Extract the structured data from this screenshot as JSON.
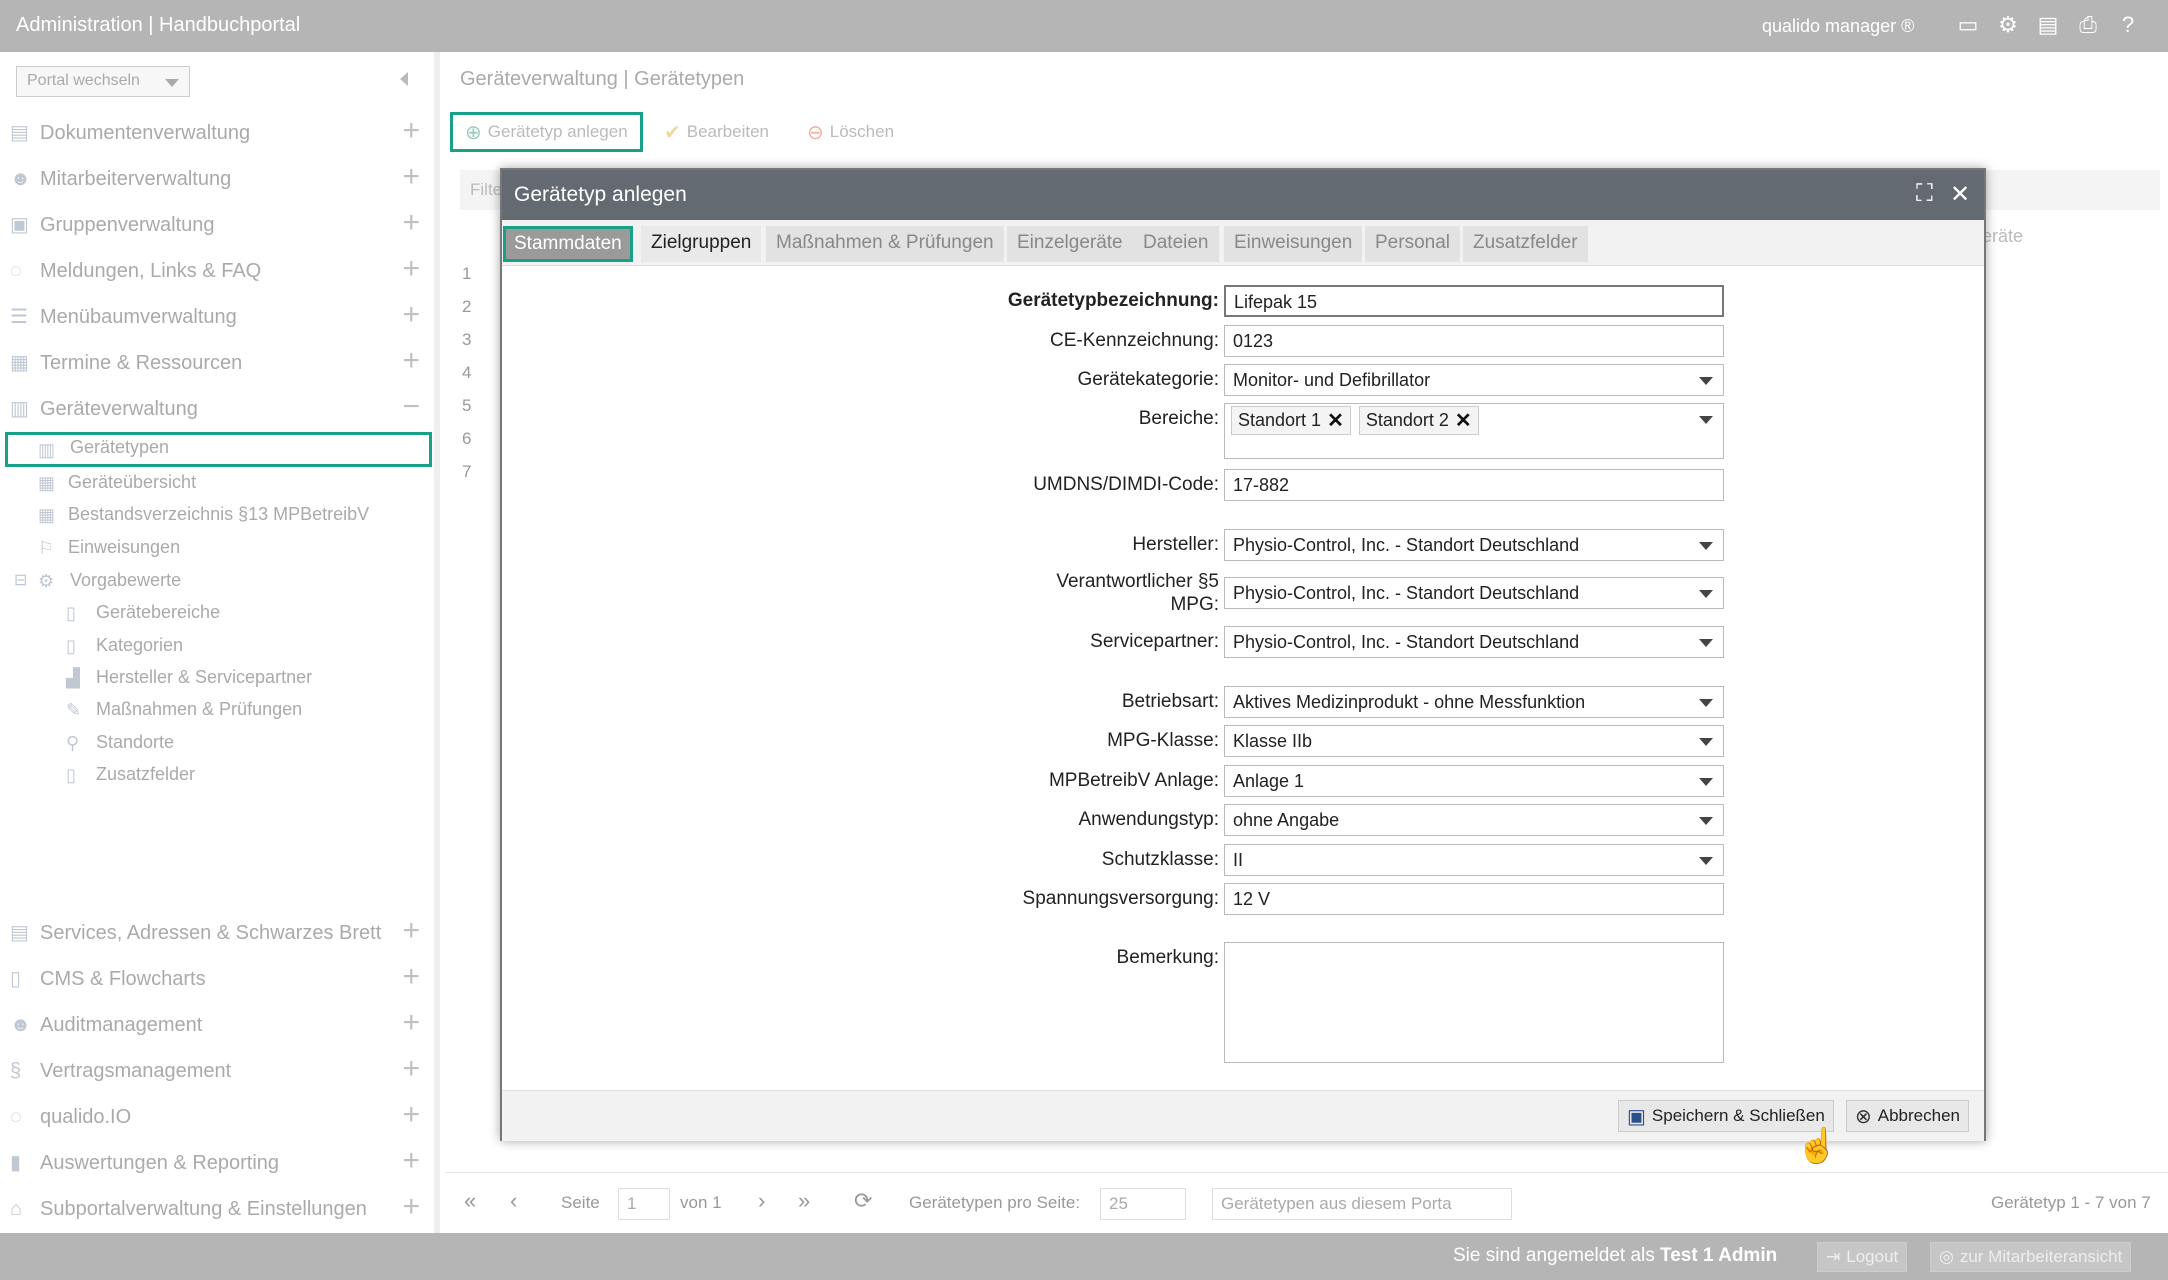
{
  "topbar": {
    "title": "Administration | Handbuchportal",
    "brand": "qualido manager ®",
    "icons": [
      "monitor-icon",
      "sitemap-icon",
      "pdf-icon",
      "print-icon",
      "help-icon"
    ]
  },
  "sidebar": {
    "portal_select": "Portal wechseln",
    "items": [
      {
        "label": "Dokumentenverwaltung",
        "icon": "documents-icon"
      },
      {
        "label": "Mitarbeiterverwaltung",
        "icon": "users-icon"
      },
      {
        "label": "Gruppenverwaltung",
        "icon": "groups-icon"
      },
      {
        "label": "Meldungen, Links & FAQ",
        "icon": "chat-icon"
      },
      {
        "label": "Menübaumverwaltung",
        "icon": "list-icon"
      },
      {
        "label": "Termine & Ressourcen",
        "icon": "calendar-icon"
      },
      {
        "label": "Geräteverwaltung",
        "icon": "device-icon"
      }
    ],
    "sub_items": [
      {
        "label": "Gerätetypen",
        "icon": "device-type-icon"
      },
      {
        "label": "Geräteübersicht",
        "icon": "grid-icon"
      },
      {
        "label": "Bestandsverzeichnis §13 MPBetreibV",
        "icon": "grid-icon"
      },
      {
        "label": "Einweisungen",
        "icon": "instruction-icon"
      },
      {
        "label": "Vorgabewerte",
        "icon": "settings-icon"
      }
    ],
    "sub_sub_items": [
      {
        "label": "Gerätebereiche",
        "icon": "page-icon"
      },
      {
        "label": "Kategorien",
        "icon": "page-icon"
      },
      {
        "label": "Hersteller & Servicepartner",
        "icon": "factory-icon"
      },
      {
        "label": "Maßnahmen & Prüfungen",
        "icon": "wrench-icon"
      },
      {
        "label": "Standorte",
        "icon": "pin-icon"
      },
      {
        "label": "Zusatzfelder",
        "icon": "page-icon"
      }
    ],
    "bottom_items": [
      {
        "label": "Services, Adressen & Schwarzes Brett",
        "icon": "board-icon"
      },
      {
        "label": "CMS & Flowcharts",
        "icon": "cms-icon"
      },
      {
        "label": "Auditmanagement",
        "icon": "audit-icon"
      },
      {
        "label": "Vertragsmanagement",
        "icon": "paragraph-icon"
      },
      {
        "label": "qualido.IO",
        "icon": "io-icon"
      },
      {
        "label": "Auswertungen & Reporting",
        "icon": "chart-icon"
      },
      {
        "label": "Subportalverwaltung & Einstellungen",
        "icon": "home-icon"
      }
    ]
  },
  "main": {
    "breadcrumb": "Geräteverwaltung | Gerätetypen",
    "toolbar": {
      "add": "Gerätetyp anlegen",
      "edit": "Bearbeiten",
      "delete": "Löschen"
    },
    "filter_placeholder": "Filte",
    "grid_col": "eräte",
    "rows": [
      "1",
      "2",
      "3",
      "4",
      "5",
      "6",
      "7"
    ],
    "pager": {
      "page_label": "Seite",
      "page": "1",
      "of": "von 1",
      "per_page_label": "Gerätetypen pro Seite:",
      "per_page": "25",
      "scope": "Gerätetypen aus diesem Porta",
      "summary": "Gerätetyp 1 - 7 von 7"
    }
  },
  "dialog": {
    "title": "Gerätetyp anlegen",
    "tabs": [
      "Stammdaten",
      "Zielgruppen",
      "Maßnahmen & Prüfungen",
      "Einzelgeräte",
      "Dateien",
      "Einweisungen",
      "Personal",
      "Zusatzfelder"
    ],
    "fields": {
      "bezeichnung": {
        "label": "Gerätetypbezeichnung:",
        "value": "Lifepak 15"
      },
      "ce": {
        "label": "CE-Kennzeichnung:",
        "value": "0123"
      },
      "kategorie": {
        "label": "Gerätekategorie:",
        "value": "Monitor- und Defibrillator"
      },
      "bereiche": {
        "label": "Bereiche:",
        "chips": [
          "Standort 1",
          "Standort 2"
        ]
      },
      "umdns": {
        "label": "UMDNS/DIMDI-Code:",
        "value": "17-882"
      },
      "hersteller": {
        "label": "Hersteller:",
        "value": "Physio-Control, Inc. - Standort Deutschland"
      },
      "verantwortlicher": {
        "label1": "Verantwortlicher §5",
        "label2": "MPG:",
        "value": "Physio-Control, Inc. - Standort Deutschland"
      },
      "service": {
        "label": "Servicepartner:",
        "value": "Physio-Control, Inc. - Standort Deutschland"
      },
      "betriebsart": {
        "label": "Betriebsart:",
        "value": "Aktives Medizinprodukt - ohne Messfunktion"
      },
      "mpg": {
        "label": "MPG-Klasse:",
        "value": "Klasse IIb"
      },
      "anlage": {
        "label": "MPBetreibV Anlage:",
        "value": "Anlage 1"
      },
      "anwendung": {
        "label": "Anwendungstyp:",
        "value": "ohne Angabe"
      },
      "schutz": {
        "label": "Schutzklasse:",
        "value": "II"
      },
      "spannung": {
        "label": "Spannungsversorgung:",
        "value": "12 V"
      },
      "bemerkung": {
        "label": "Bemerkung:",
        "value": ""
      }
    },
    "buttons": {
      "save": "Speichern & Schließen",
      "cancel": "Abbrechen"
    }
  },
  "bottombar": {
    "logged_in_prefix": "Sie sind angemeldet als",
    "user": "Test 1 Admin",
    "logout": "Logout",
    "switch": "zur Mitarbeiteransicht"
  },
  "colors": {
    "accent": "#18a089",
    "dialog_header": "#646a72",
    "bar": "#b5b5b5"
  }
}
